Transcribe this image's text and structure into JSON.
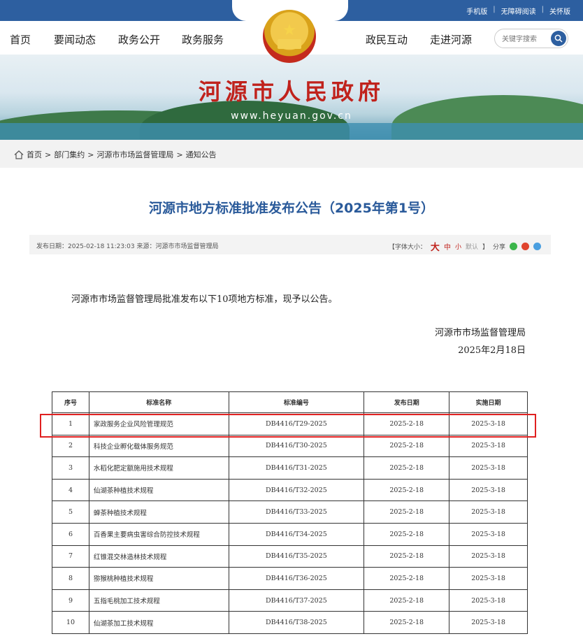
{
  "top_links": [
    "手机版",
    "无障碍阅读",
    "关怀版"
  ],
  "nav": {
    "left": [
      "首页",
      "要闻动态",
      "政务公开",
      "政务服务"
    ],
    "right": [
      "政民互动",
      "走进河源"
    ],
    "search_placeholder": "关键字搜索"
  },
  "banner": {
    "title": "河源市人民政府",
    "url": "www.heyuan.gov.cn"
  },
  "breadcrumb": [
    "首页",
    "部门集约",
    "河源市市场监督管理局",
    "通知公告"
  ],
  "article": {
    "title": "河源市地方标准批准发布公告（2025年第1号）",
    "meta_left": "发布日期：2025-02-18 11:23:03 来源：河源市市场监督管理局",
    "font_size_label": "【字体大小：",
    "font_big": "大",
    "font_mid": "中",
    "font_small": "小",
    "font_default": "默认",
    "font_close": "】",
    "share_label": "分享",
    "paragraph": "河源市市场监督管理局批准发布以下10项地方标准，现予以公告。",
    "signature_org": "河源市市场监督管理局",
    "signature_date": "2025年2月18日"
  },
  "table": {
    "headers": [
      "序号",
      "标准名称",
      "标准编号",
      "发布日期",
      "实施日期"
    ],
    "rows": [
      [
        "1",
        "家政服务企业风险管理规范",
        "DB4416/T29-2025",
        "2025-2-18",
        "2025-3-18"
      ],
      [
        "2",
        "科技企业孵化载体服务规范",
        "DB4416/T30-2025",
        "2025-2-18",
        "2025-3-18"
      ],
      [
        "3",
        "水稻化肥定额施用技术规程",
        "DB4416/T31-2025",
        "2025-2-18",
        "2025-3-18"
      ],
      [
        "4",
        "仙湖茶种植技术规程",
        "DB4416/T32-2025",
        "2025-2-18",
        "2025-3-18"
      ],
      [
        "5",
        "蝉茶种植技术规程",
        "DB4416/T33-2025",
        "2025-2-18",
        "2025-3-18"
      ],
      [
        "6",
        "百香果主要病虫害综合防控技术规程",
        "DB4416/T34-2025",
        "2025-2-18",
        "2025-3-18"
      ],
      [
        "7",
        "红锥混交林造林技术规程",
        "DB4416/T35-2025",
        "2025-2-18",
        "2025-3-18"
      ],
      [
        "8",
        "猕猴桃种植技术规程",
        "DB4416/T36-2025",
        "2025-2-18",
        "2025-3-18"
      ],
      [
        "9",
        "五指毛桃加工技术规程",
        "DB4416/T37-2025",
        "2025-2-18",
        "2025-3-18"
      ],
      [
        "10",
        "仙湖茶加工技术规程",
        "DB4416/T38-2025",
        "2025-2-18",
        "2025-3-18"
      ]
    ]
  },
  "colors": {
    "brand_blue": "#2d5fa0",
    "title_red": "#c0221c",
    "highlight": "#e02020"
  }
}
